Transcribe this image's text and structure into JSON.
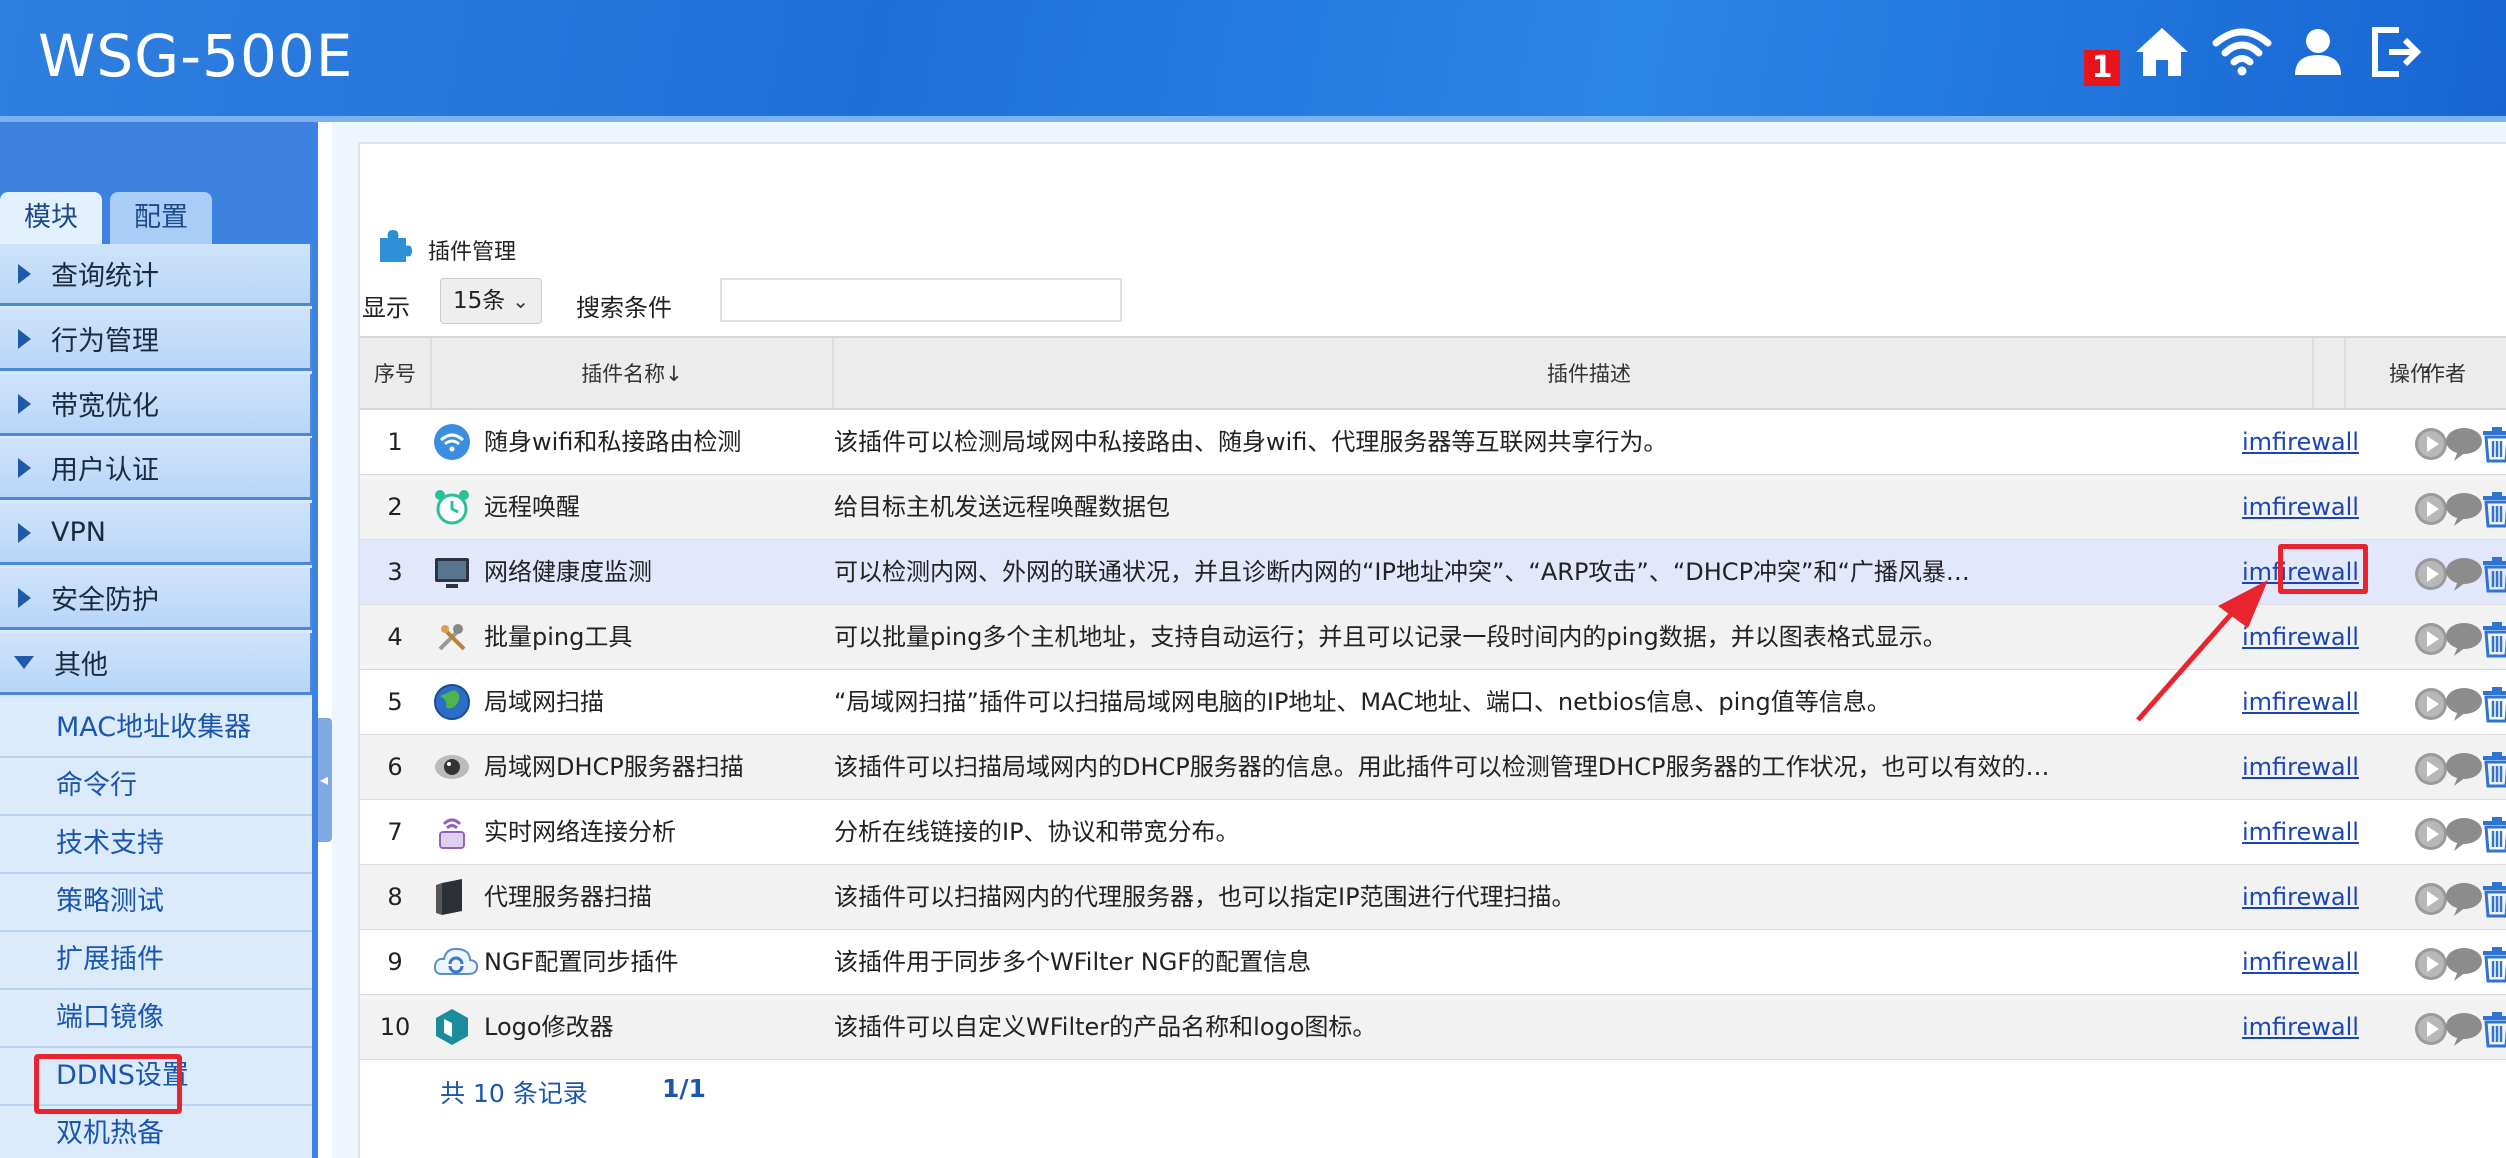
{
  "header": {
    "title": "WSG-500E",
    "notification_count": "1",
    "icons": [
      "home-icon",
      "wifi-icon",
      "user-icon",
      "logout-icon"
    ]
  },
  "sidebar": {
    "tabs": [
      {
        "label": "模块"
      },
      {
        "label": "配置"
      }
    ],
    "groups": [
      {
        "label": "查询统计"
      },
      {
        "label": "行为管理"
      },
      {
        "label": "带宽优化"
      },
      {
        "label": "用户认证"
      },
      {
        "label": "VPN"
      },
      {
        "label": "安全防护"
      },
      {
        "label": "其他"
      }
    ],
    "sub_items": [
      {
        "label": "MAC地址收集器"
      },
      {
        "label": "命令行"
      },
      {
        "label": "技术支持"
      },
      {
        "label": "策略测试"
      },
      {
        "label": "扩展插件"
      },
      {
        "label": "端口镜像"
      },
      {
        "label": "DDNS设置"
      },
      {
        "label": "双机热备"
      }
    ]
  },
  "main": {
    "title": "插件管理",
    "show_label": "显示",
    "page_size": "15条",
    "search_label": "搜索条件",
    "search_value": "",
    "columns": [
      "序号",
      "插件名称↓",
      "插件描述",
      "作者",
      "操作"
    ],
    "rows": [
      {
        "no": "1",
        "name": "随身wifi和私接路由检测",
        "desc": "该插件可以检测局域网中私接路由、随身wifi、代理服务器等互联网共享行为。",
        "author": "imfirewall",
        "icon": "wifi-signal-icon"
      },
      {
        "no": "2",
        "name": "远程唤醒",
        "desc": "给目标主机发送远程唤醒数据包",
        "author": "imfirewall",
        "icon": "alarm-clock-icon"
      },
      {
        "no": "3",
        "name": "网络健康度监测",
        "desc": "可以检测内网、外网的联通状况，并且诊断内网的“IP地址冲突”、“ARP攻击”、“DHCP冲突”和“广播风暴…",
        "author": "imfirewall",
        "icon": "monitor-icon"
      },
      {
        "no": "4",
        "name": "批量ping工具",
        "desc": "可以批量ping多个主机地址，支持自动运行；并且可以记录一段时间内的ping数据，并以图表格式显示。",
        "author": "imfirewall",
        "icon": "tools-icon"
      },
      {
        "no": "5",
        "name": "局域网扫描",
        "desc": "“局域网扫描”插件可以扫描局域网电脑的IP地址、MAC地址、端口、netbios信息、ping值等信息。",
        "author": "imfirewall",
        "icon": "globe-icon"
      },
      {
        "no": "6",
        "name": "局域网DHCP服务器扫描",
        "desc": "该插件可以扫描局域网内的DHCP服务器的信息。用此插件可以检测管理DHCP服务器的工作状况，也可以有效的…",
        "author": "imfirewall",
        "icon": "eye-icon"
      },
      {
        "no": "7",
        "name": "实时网络连接分析",
        "desc": "分析在线链接的IP、协议和带宽分布。",
        "author": "imfirewall",
        "icon": "signal-tower-icon"
      },
      {
        "no": "8",
        "name": "代理服务器扫描",
        "desc": "该插件可以扫描网内的代理服务器，也可以指定IP范围进行代理扫描。",
        "author": "imfirewall",
        "icon": "server-icon"
      },
      {
        "no": "9",
        "name": "NGF配置同步插件",
        "desc": "该插件用于同步多个WFilter  NGF的配置信息",
        "author": "imfirewall",
        "icon": "cloud-sync-icon"
      },
      {
        "no": "10",
        "name": "Logo修改器",
        "desc": "该插件可以自定义WFilter的产品名称和logo图标。",
        "author": "imfirewall",
        "icon": "logo-icon"
      }
    ],
    "footer": {
      "count": "共  10  条记录",
      "page": "1/1"
    }
  },
  "colors": {
    "header_blue": "#2a7fe0",
    "highlight_red": "#e8252e",
    "link_blue": "#1a45b6",
    "row_highlight": "#e3e7fb"
  }
}
